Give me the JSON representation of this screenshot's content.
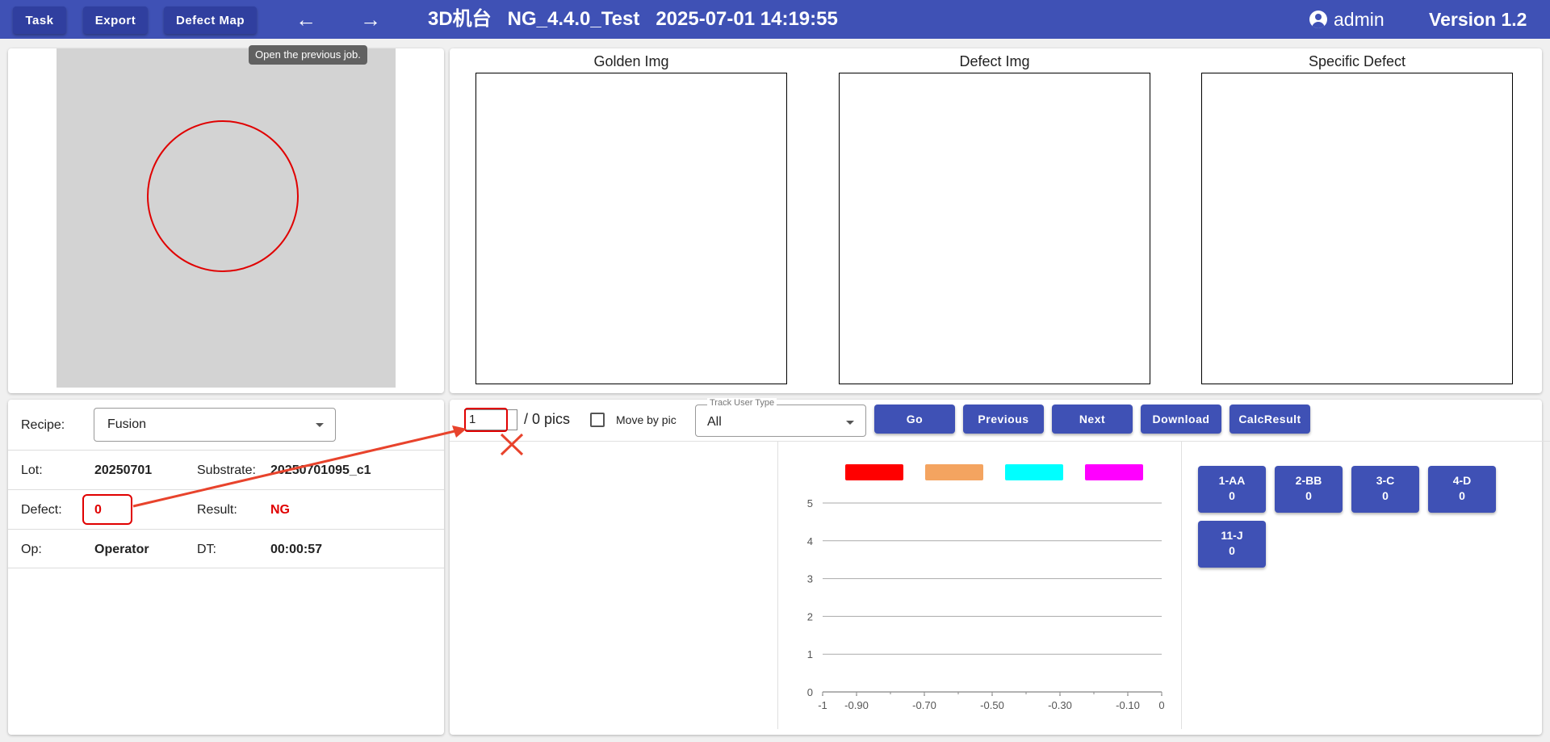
{
  "toolbar": {
    "task_label": "Task",
    "export_label": "Export",
    "defect_map_label": "Defect Map",
    "back_icon": "arrow-left-icon",
    "forward_icon": "arrow-right-icon",
    "title": "3D机台   NG_4.4.0_Test   2025-07-01 14:19:55",
    "user": "admin",
    "version": "Version 1.2"
  },
  "tooltip": "Open the previous job.",
  "images": {
    "golden": "Golden Img",
    "defect": "Defect Img",
    "specific": "Specific Defect"
  },
  "info": {
    "recipe_label": "Recipe:",
    "recipe_value": "Fusion",
    "lot_label": "Lot:",
    "lot_value": "20250701",
    "substrate_label": "Substrate:",
    "substrate_value": "20250701095_c1",
    "defect_label": "Defect:",
    "defect_value": "0",
    "result_label": "Result:",
    "result_value": "NG",
    "op_label": "Op:",
    "op_value": "Operator",
    "dt_label": "DT:",
    "dt_value": "00:00:57"
  },
  "controls": {
    "pic_index": "1",
    "pic_total": "/ 0 pics",
    "move_by_pic": "Move by pic",
    "track_label": "Track User Type",
    "track_value": "All",
    "go": "Go",
    "previous": "Previous",
    "next": "Next",
    "download": "Download",
    "calc": "CalcResult"
  },
  "chart_data": {
    "type": "bar",
    "legend_colors": [
      "#ff0000",
      "#f4a460",
      "#00ffff",
      "#ff00ff"
    ],
    "xticks": [
      "-1",
      "-0.90",
      "-0.70",
      "-0.50",
      "-0.30",
      "-0.10",
      "0"
    ],
    "xlim": [
      -1,
      0
    ],
    "ylim": [
      0,
      5
    ],
    "yticks": [
      "0",
      "1",
      "2",
      "3",
      "4",
      "5"
    ],
    "series": [],
    "grid": true
  },
  "defect_counts": [
    {
      "label": "1-AA",
      "count": "0"
    },
    {
      "label": "2-BB",
      "count": "0"
    },
    {
      "label": "3-C",
      "count": "0"
    },
    {
      "label": "4-D",
      "count": "0"
    },
    {
      "label": "11-J",
      "count": "0"
    }
  ],
  "colors": {
    "primary": "#3f51b5",
    "primary_dark": "#303f9f",
    "ng": "#e00000",
    "annotation": "#e8432c"
  }
}
